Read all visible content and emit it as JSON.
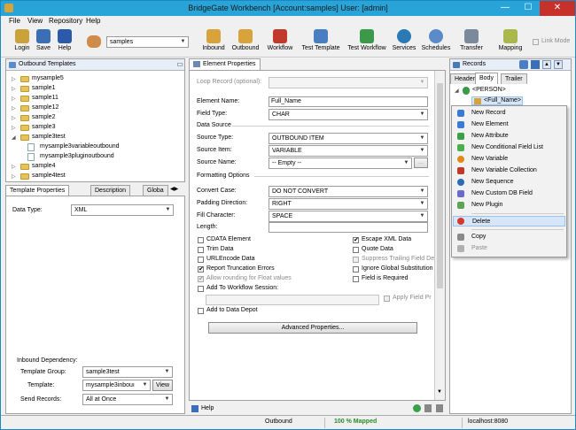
{
  "window": {
    "title": "BridgeGate Workbench [Account:samples] User: [admin]",
    "minimize": "—",
    "maximize": "☐",
    "close": "✕"
  },
  "menu": [
    "File",
    "View",
    "Repository",
    "Help"
  ],
  "toolbar": {
    "login": "Login",
    "save": "Save",
    "help": "Help",
    "account_value": "samples",
    "inbound": "Inbound",
    "outbound": "Outbound",
    "workflow": "Workflow",
    "test_template": "Test Template",
    "test_workflow": "Test Workflow",
    "services": "Services",
    "schedules": "Schedules",
    "transfer": "Transfer",
    "mapping": "Mapping",
    "link_mode": "Link Mode"
  },
  "left": {
    "header": "Outbound Templates",
    "tree": [
      {
        "label": "mysample5",
        "type": "folder",
        "expanded": false,
        "level": 0
      },
      {
        "label": "sample1",
        "type": "folder",
        "expanded": false,
        "level": 0
      },
      {
        "label": "sample11",
        "type": "folder",
        "expanded": false,
        "level": 0
      },
      {
        "label": "sample12",
        "type": "folder",
        "expanded": false,
        "level": 0
      },
      {
        "label": "sample2",
        "type": "folder",
        "expanded": false,
        "level": 0
      },
      {
        "label": "sample3",
        "type": "folder",
        "expanded": false,
        "level": 0
      },
      {
        "label": "sample3test",
        "type": "folder",
        "expanded": true,
        "level": 0
      },
      {
        "label": "mysample3variableoutbound",
        "type": "doc",
        "level": 1
      },
      {
        "label": "mysample3pluginoutbound",
        "type": "doc",
        "level": 1
      },
      {
        "label": "sample4",
        "type": "folder",
        "expanded": false,
        "level": 0
      },
      {
        "label": "sample4test",
        "type": "folder",
        "expanded": false,
        "level": 0
      }
    ],
    "tabs": [
      "Template Properties",
      "Description",
      "Globa"
    ],
    "data_type_label": "Data Type:",
    "data_type_value": "XML",
    "inbound_dependency": "Inbound Dependency:",
    "template_group_label": "Template Group:",
    "template_group_value": "sample3test",
    "template_label": "Template:",
    "template_value": "mysample3inbouı",
    "view_button": "View",
    "send_records_label": "Send Records:",
    "send_records_value": "All at Once"
  },
  "middle": {
    "tab": "Element Properties",
    "loop_record_label": "Loop Record (optional):",
    "element_name_label": "Element Name:",
    "element_name_value": "Full_Name",
    "field_type_label": "Field Type:",
    "field_type_value": "CHAR",
    "data_source": "Data Source",
    "source_type_label": "Source Type:",
    "source_type_value": "OUTBOUND ITEM",
    "source_item_label": "Source Item:",
    "source_item_value": "VARIABLE",
    "source_name_label": "Source Name:",
    "source_name_value": "-- Empty --",
    "ellipsis": "...",
    "formatting_options": "Formatting Options",
    "convert_case_label": "Convert Case:",
    "convert_case_value": "DO NOT CONVERT",
    "padding_dir_label": "Padding Direction:",
    "padding_dir_value": "RIGHT",
    "fill_char_label": "Fill Character:",
    "fill_char_value": "SPACE",
    "length_label": "Length:",
    "cdata": "CDATA Element",
    "trim": "Trim Data",
    "urlencode": "URLEncode Data",
    "report_trunc": "Report Truncation Errors",
    "allow_round": "Allow rounding for Float values",
    "add_workflow": "Add To Workflow Session:",
    "escape_xml": "Escape XML Data",
    "quote": "Quote Data",
    "suppress_trailing": "Suppress Trailing Field De",
    "ignore_global": "Ignore Global Substitution",
    "field_required": "Field is Required",
    "apply_field": "Apply Field Pr",
    "add_depot": "Add to Data Depot",
    "advanced": "Advanced Properties...",
    "help": "Help"
  },
  "right": {
    "header": "Records",
    "tabs": [
      "Header",
      "Body",
      "Trailer"
    ],
    "tree_root": "<PERSON>",
    "tree_child": "<Full_Name>",
    "context_menu": [
      {
        "label": "New Record",
        "icon": "record-icon",
        "color": "#3a7bd5"
      },
      {
        "label": "New Element",
        "icon": "element-icon",
        "color": "#3a7bd5"
      },
      {
        "label": "New Attribute",
        "icon": "attribute-icon",
        "color": "#3aa04a"
      },
      {
        "label": "New Conditional Field List",
        "icon": "conditional-icon",
        "color": "#4ab04a"
      },
      {
        "label": "New Variable",
        "icon": "variable-icon",
        "color": "#e08a1a"
      },
      {
        "label": "New Variable Collection",
        "icon": "variable-collection-icon",
        "color": "#c0392b"
      },
      {
        "label": "New Sequence",
        "icon": "sequence-icon",
        "color": "#2c6bb5"
      },
      {
        "label": "New Custom DB Field",
        "icon": "db-field-icon",
        "color": "#6a6ac8"
      },
      {
        "label": "New Plugin",
        "icon": "plugin-icon",
        "color": "#5aa55a"
      },
      {
        "label": "Delete",
        "icon": "delete-icon",
        "color": "#d63a2a"
      },
      {
        "label": "Copy",
        "icon": "copy-icon",
        "color": "#8a8a8a"
      },
      {
        "label": "Paste",
        "icon": "paste-icon",
        "color": "#b0b0b0"
      }
    ]
  },
  "status": {
    "mode": "Outbound",
    "mapped": "100 % Mapped",
    "server": "localhost:8080"
  }
}
